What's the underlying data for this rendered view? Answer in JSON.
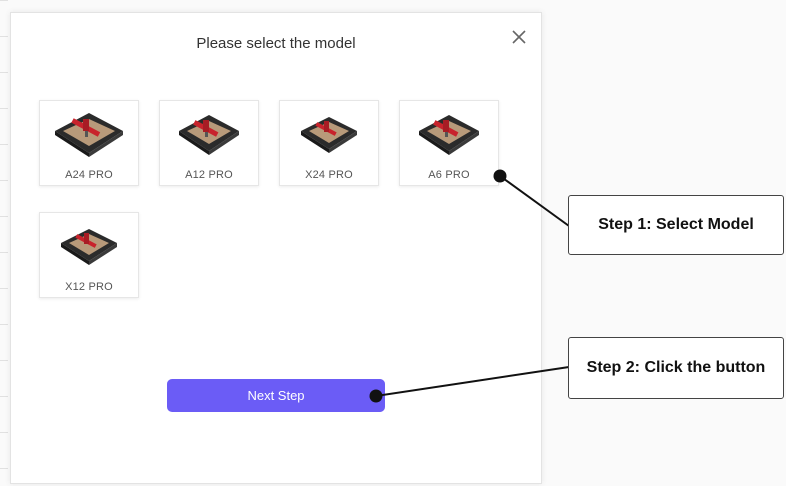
{
  "dialog": {
    "title": "Please select the model",
    "close_icon": "close-icon",
    "next_label": "Next Step"
  },
  "models": [
    {
      "label": "A24 PRO",
      "icon": "laser-engraver-icon"
    },
    {
      "label": "A12 PRO",
      "icon": "laser-engraver-icon"
    },
    {
      "label": "X24 PRO",
      "icon": "laser-engraver-icon"
    },
    {
      "label": "A6 PRO",
      "icon": "laser-engraver-icon"
    },
    {
      "label": "X12 PRO",
      "icon": "laser-engraver-icon"
    }
  ],
  "annotations": {
    "step1": "Step 1:  Select Model",
    "step2": "Step 2:  Click the button"
  },
  "colors": {
    "accent": "#6b5cf6",
    "callout_border": "#444444",
    "laser_red": "#c8232c"
  }
}
